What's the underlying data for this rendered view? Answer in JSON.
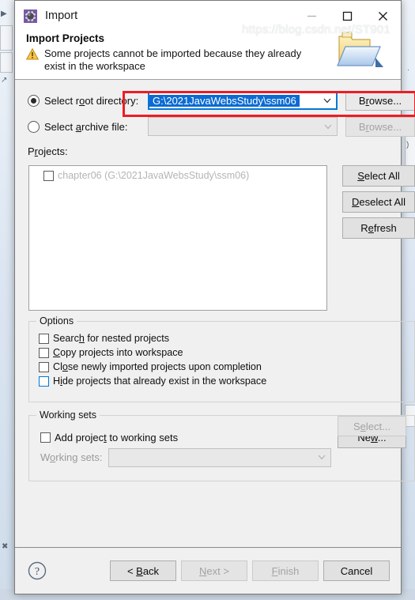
{
  "window": {
    "title": "Import",
    "app_icon": "eclipse-gear-icon",
    "controls": {
      "minimize": "minimize-icon",
      "maximize": "maximize-icon",
      "close": "close-icon"
    }
  },
  "header": {
    "title": "Import Projects",
    "status_icon": "warning-icon",
    "message": "Some projects cannot be imported because they already exist in the workspace",
    "art_icon": "open-folder-icon"
  },
  "source": {
    "root_directory": {
      "label_before": "Select r",
      "label_accel": "o",
      "label_after": "ot directory:",
      "label_full": "Select root directory:",
      "selected": true,
      "value": "G:\\2021JavaWebsStudy\\ssm06",
      "value_is_selected_text": true,
      "browse_label": "Browse...",
      "browse_accel": "r",
      "browse_enabled": true
    },
    "archive_file": {
      "label_before": "Select ",
      "label_accel": "a",
      "label_after": "rchive file:",
      "label_full": "Select archive file:",
      "selected": false,
      "value": "",
      "browse_label": "Browse...",
      "browse_accel": "r",
      "browse_enabled": false
    }
  },
  "projects": {
    "label_before": "P",
    "label_accel": "r",
    "label_after": "ojects:",
    "label_full": "Projects:",
    "items": [
      {
        "checked": false,
        "enabled": false,
        "text": "chapter06 (G:\\2021JavaWebsStudy\\ssm06)"
      }
    ],
    "buttons": [
      {
        "label_before": "",
        "accel": "S",
        "label_after": "elect All",
        "label_full": "Select All",
        "enabled": true
      },
      {
        "label_before": "",
        "accel": "D",
        "label_after": "eselect All",
        "label_full": "Deselect All",
        "enabled": true
      },
      {
        "label_before": "R",
        "accel": "e",
        "label_after": "fresh",
        "label_full": "Refresh",
        "enabled": true
      }
    ]
  },
  "options": {
    "title": "Options",
    "items": [
      {
        "label_before": "Searc",
        "accel": "h",
        "label_after": " for nested projects",
        "label_full": "Search for nested projects",
        "checked": false,
        "focused": false
      },
      {
        "label_before": "",
        "accel": "C",
        "label_after": "opy projects into workspace",
        "label_full": "Copy projects into workspace",
        "checked": false,
        "focused": false
      },
      {
        "label_before": "Cl",
        "accel": "o",
        "label_after": "se newly imported projects upon completion",
        "label_full": "Close newly imported projects upon completion",
        "checked": false,
        "focused": false
      },
      {
        "label_before": "H",
        "accel": "i",
        "label_after": "de projects that already exist in the workspace",
        "label_full": "Hide projects that already exist in the workspace",
        "checked": false,
        "focused": true
      }
    ]
  },
  "working_sets": {
    "title": "Working sets",
    "add_checkbox": {
      "label_before": "Add projec",
      "accel": "t",
      "label_after": " to working sets",
      "label_full": "Add project to working sets",
      "checked": false
    },
    "new_button": {
      "label_before": "Ne",
      "accel": "w",
      "label_after": "...",
      "label_full": "New...",
      "enabled": true
    },
    "sets_label_before": "W",
    "sets_label_accel": "o",
    "sets_label_after": "rking sets:",
    "sets_label_full": "Working sets:",
    "sets_value": "",
    "sets_enabled": false,
    "select_button": {
      "label_before": "S",
      "accel": "e",
      "label_after": "lect...",
      "label_full": "Select...",
      "enabled": false
    }
  },
  "footer": {
    "help_icon": "help-question-icon",
    "buttons": [
      {
        "label_before": "< ",
        "accel": "B",
        "label_after": "ack",
        "label_full": "< Back",
        "enabled": true
      },
      {
        "label_before": "",
        "accel": "N",
        "label_after": "ext >",
        "label_full": "Next >",
        "enabled": false
      },
      {
        "label_before": "",
        "accel": "F",
        "label_after": "inish",
        "label_full": "Finish",
        "enabled": false
      },
      {
        "label_before": "Cancel",
        "accel": "",
        "label_after": "",
        "label_full": "Cancel",
        "enabled": true
      }
    ]
  },
  "watermark": "https://blog.csdn.net/ST901",
  "colors": {
    "accent": "#0078d7",
    "selection": "#0b6bd2",
    "annotation": "#ee1c25",
    "dialog_bg": "#f0f0f0",
    "warning": "#f5b731"
  }
}
